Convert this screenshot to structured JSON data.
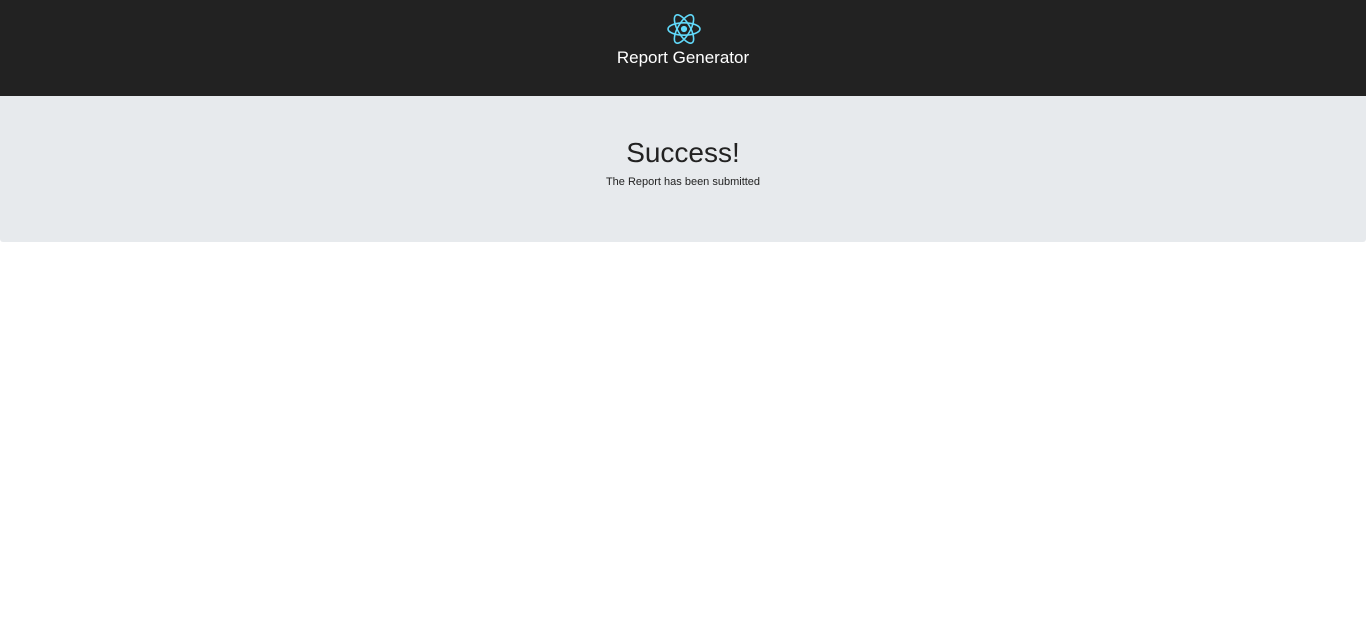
{
  "header": {
    "logo_icon": "react-atom-icon",
    "logo_color": "#61dafb",
    "background_color": "#222222",
    "title": "Report Generator"
  },
  "main": {
    "background_color": "#e7eaed",
    "heading": "Success!",
    "message": "The Report has been submitted"
  }
}
